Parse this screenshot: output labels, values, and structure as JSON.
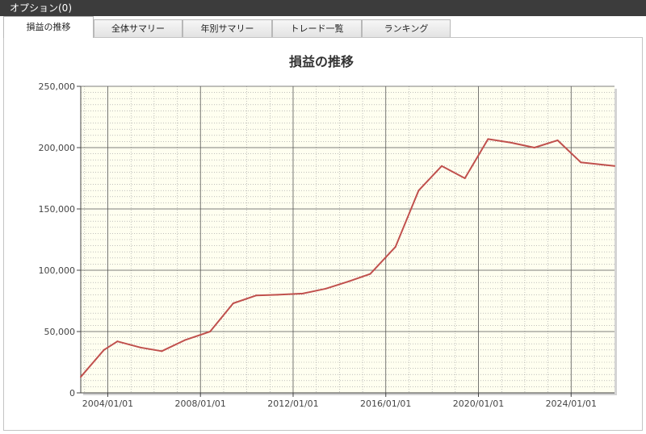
{
  "window": {
    "title": "オプション(0)"
  },
  "tabs": [
    {
      "label": "損益の推移",
      "active": true
    },
    {
      "label": "全体サマリー",
      "active": false
    },
    {
      "label": "年別サマリー",
      "active": false
    },
    {
      "label": "トレード一覧",
      "active": false
    },
    {
      "label": "ランキング",
      "active": false
    }
  ],
  "colors": {
    "line": "#c0504d",
    "plot_background": "#fffff0",
    "title_bar": "#3c3c3c"
  },
  "chart_data": {
    "type": "line",
    "title": "損益の推移",
    "xlabel": "",
    "ylabel": "",
    "x_axis_type": "date",
    "xlim": [
      "2002/11/01",
      "2025/11/15"
    ],
    "ylim": [
      0,
      250000
    ],
    "grid": {
      "major": true,
      "minor": true
    },
    "legend": "none",
    "yticks": [
      0,
      50000,
      100000,
      150000,
      200000,
      250000
    ],
    "ytick_labels": [
      "0",
      "50,000",
      "100,000",
      "150,000",
      "200,000",
      "250,000"
    ],
    "xticks": [
      "2004/01/01",
      "2008/01/01",
      "2012/01/01",
      "2016/01/01",
      "2020/01/01",
      "2024/01/01"
    ],
    "xtick_labels": [
      "2004/01/01",
      "2008/01/01",
      "2012/01/01",
      "2016/01/01",
      "2020/01/01",
      "2024/01/01"
    ],
    "series": [
      {
        "x": [
          "2002/11/01",
          "2003/11/01",
          "2004/06/01",
          "2005/06/01",
          "2006/05/01",
          "2007/05/01",
          "2008/06/01",
          "2009/06/01",
          "2010/06/01",
          "2011/05/01",
          "2012/06/01",
          "2013/06/01",
          "2014/06/01",
          "2015/05/01",
          "2016/06/01",
          "2017/06/01",
          "2018/06/01",
          "2019/06/01",
          "2020/06/01",
          "2021/06/01",
          "2022/06/01",
          "2023/06/01",
          "2024/06/01",
          "2025/11/15"
        ],
        "values": [
          13000,
          35000,
          42000,
          37000,
          34000,
          43000,
          50000,
          73000,
          79500,
          80000,
          81000,
          85000,
          91000,
          97000,
          119000,
          165000,
          185000,
          175000,
          207000,
          204000,
          200000,
          206000,
          188000,
          185000
        ]
      }
    ]
  }
}
